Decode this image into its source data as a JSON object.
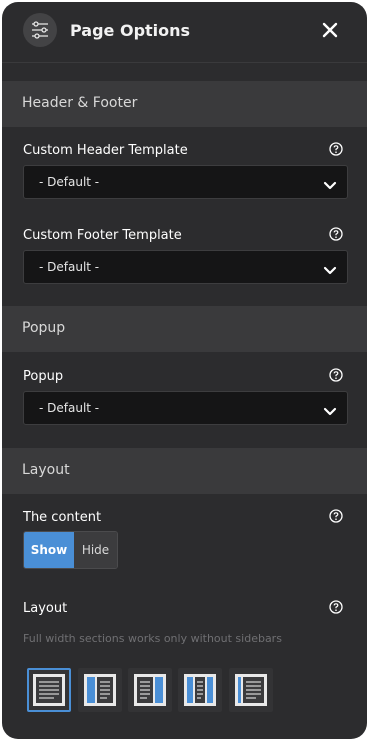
{
  "header": {
    "title": "Page Options",
    "icon": "sliders-icon",
    "close_icon": "close-icon"
  },
  "sections": {
    "header_footer": {
      "title": "Header & Footer",
      "custom_header": {
        "label": "Custom Header Template",
        "value": "- Default -"
      },
      "custom_footer": {
        "label": "Custom Footer Template",
        "value": "- Default -"
      }
    },
    "popup": {
      "title": "Popup",
      "popup_field": {
        "label": "Popup",
        "value": "- Default -"
      }
    },
    "layout": {
      "title": "Layout",
      "content": {
        "label": "The content",
        "show_label": "Show",
        "hide_label": "Hide",
        "selected": "Show"
      },
      "layout_field": {
        "label": "Layout",
        "note": "Full width sections works only without sidebars",
        "options": [
          "full-width",
          "left-sidebar",
          "right-sidebar",
          "both-sidebars",
          "narrow-left-sidebar"
        ],
        "selected": "full-width"
      }
    }
  },
  "colors": {
    "accent": "#4a8fd6",
    "panel": "#2c2c2e",
    "section": "#3a3a3c",
    "select": "#151516"
  }
}
